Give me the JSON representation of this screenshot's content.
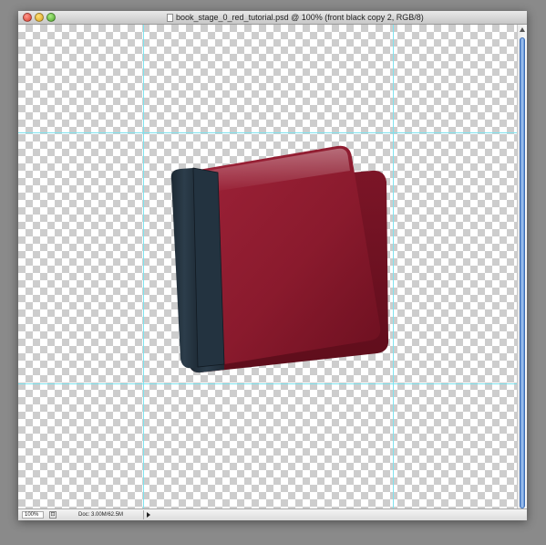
{
  "window": {
    "title": "book_stage_0_red_tutorial.psd @ 100% (front black copy 2, RGB/8)"
  },
  "status": {
    "zoom": "100%",
    "doc_info": "Doc: 3.00M/62.5M"
  },
  "colors": {
    "cover_red": "#8b1a2d",
    "spine_dark": "#243441",
    "guide_cyan": "#7ee3ef",
    "scroll_blue": "#5d8fd6"
  }
}
